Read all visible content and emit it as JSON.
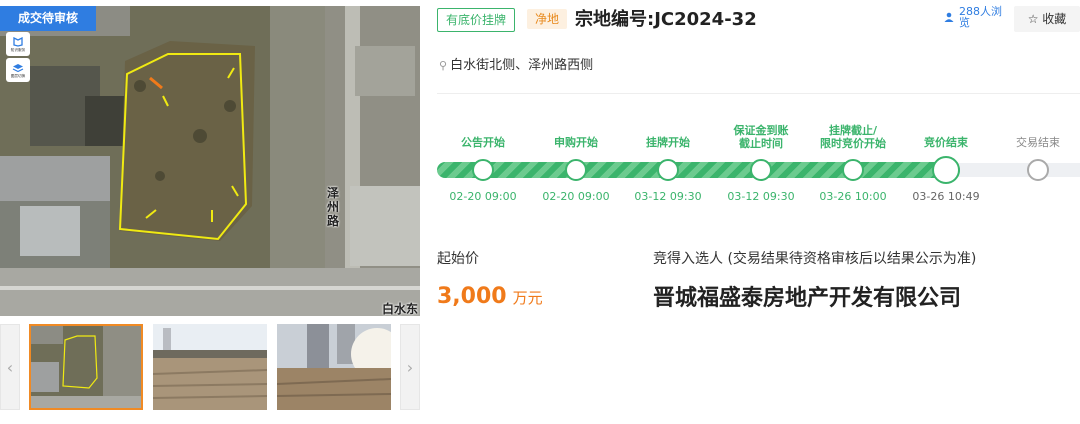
{
  "status_tag": "成交待审核",
  "map": {
    "tools": [
      {
        "name": "knowledge",
        "label": "知识服务"
      },
      {
        "name": "layers",
        "label": "图层切换"
      }
    ],
    "road_labels": {
      "vertical": "泽州路",
      "corner": "白水东"
    },
    "parcel_color": "#f0ea12"
  },
  "thumbnails": [
    {
      "name": "aerial-thumb",
      "active": true
    },
    {
      "name": "field-thumb-1",
      "active": false
    },
    {
      "name": "field-thumb-2",
      "active": false
    }
  ],
  "info": {
    "tag_reserve": "有底价挂牌",
    "tag_net": "净地",
    "title": "宗地编号:JC2024-32",
    "views": "288人浏览",
    "favorite": "☆ 收藏",
    "address": "白水街北侧、泽州路西侧"
  },
  "timeline": {
    "steps": [
      {
        "label": "公告开始",
        "time": "02-20 09:00",
        "state": "done"
      },
      {
        "label": "申购开始",
        "time": "02-20 09:00",
        "state": "done"
      },
      {
        "label": "挂牌开始",
        "time": "03-12 09:30",
        "state": "done"
      },
      {
        "label": "保证金到账\n截止时间",
        "time": "03-12 09:30",
        "state": "done"
      },
      {
        "label": "挂牌截止/\n限时竞价开始",
        "time": "03-26 10:00",
        "state": "done"
      },
      {
        "label": "竞价结束",
        "time": "03-26 10:49",
        "state": "current"
      },
      {
        "label": "交易结束",
        "time": "",
        "state": "future"
      }
    ]
  },
  "price": {
    "label": "起始价",
    "value": "3,000",
    "unit": "万元"
  },
  "winner": {
    "label": "竞得入选人 (交易结果待资格审核后以结果公示为准)",
    "name": "晋城福盛泰房地产开发有限公司"
  },
  "colors": {
    "accent_green": "#3bb46c",
    "accent_blue": "#2f7de1",
    "price_orange": "#f07a1a"
  }
}
